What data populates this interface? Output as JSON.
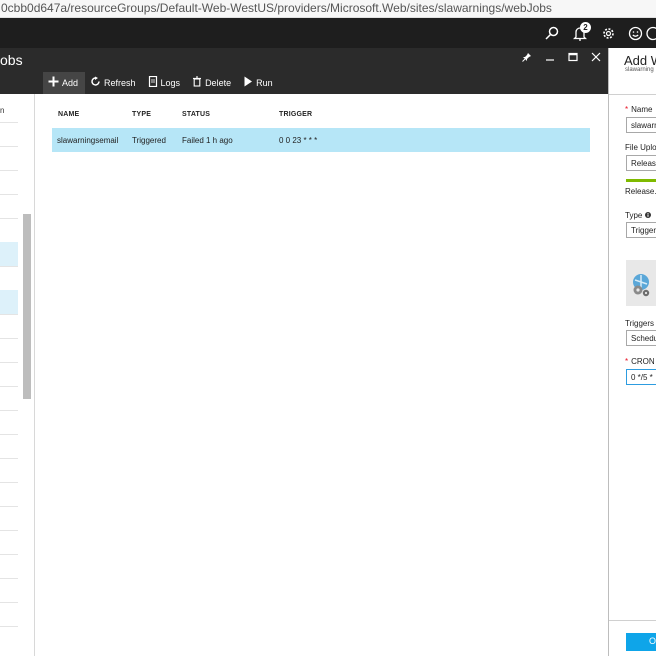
{
  "browser": {
    "address": "0cbb0d647a/resourceGroups/Default-Web-WestUS/providers/Microsoft.Web/sites/slawarnings/webJobs"
  },
  "topbar": {
    "notification_count": "2",
    "icons": [
      "search-icon",
      "bell-icon",
      "gear-icon",
      "smiley-icon",
      "help-icon"
    ]
  },
  "blade": {
    "title": "obs",
    "controls": [
      "pin-icon",
      "minimize-icon",
      "maximize-icon",
      "close-icon"
    ],
    "commands": [
      {
        "icon": "plus-icon",
        "label": "Add"
      },
      {
        "icon": "refresh-icon",
        "label": "Refresh"
      },
      {
        "icon": "document-icon",
        "label": "Logs"
      },
      {
        "icon": "trash-icon",
        "label": "Delete"
      },
      {
        "icon": "play-icon",
        "label": "Run"
      }
    ],
    "table": {
      "headers": [
        "NAME",
        "TYPE",
        "STATUS",
        "TRIGGER"
      ],
      "rows": [
        {
          "name": "slawarningsemail",
          "type": "Triggered",
          "status": "Failed 1 h ago",
          "trigger": "0 0 23 * * *"
        }
      ]
    }
  },
  "left_blade": {
    "partial_text": "n"
  },
  "add_webjob": {
    "title": "Add W",
    "subtitle": "slawarning",
    "name_label": "Name",
    "name_value": "slawarn",
    "file_upload_label": "File Uplo",
    "file_upload_value": "Release",
    "uploaded_file": "Release.z",
    "type_label": "Type",
    "type_value": "Trigger",
    "triggers_label": "Triggers",
    "triggers_value": "Schedu",
    "cron_label": "CRON",
    "cron_value": "0 */5 *",
    "ok_label": "O",
    "accent": "#0ea5e9",
    "progress_fraction": 1.0
  },
  "colors": {
    "topbar": "#1e1e1e",
    "blade_header": "#2b2b2b",
    "selected_row": "#b6e6f7",
    "progress": "#7fba00"
  }
}
